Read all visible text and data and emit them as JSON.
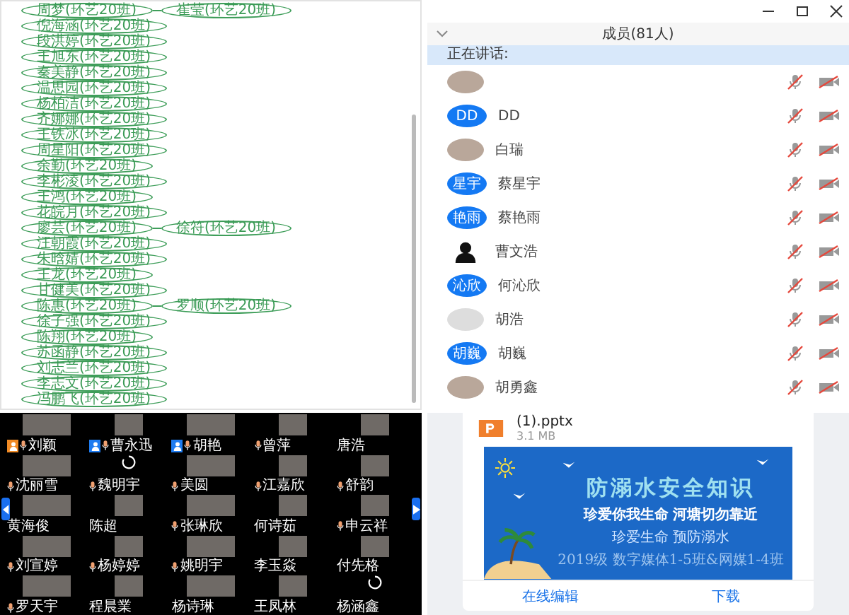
{
  "mindmap": {
    "items": [
      {
        "label": "周梦(环艺20班)",
        "children": [
          {
            "label": "崔莹(环艺20班)"
          }
        ]
      },
      {
        "label": "倪海涵(环艺20班)"
      },
      {
        "label": "段洪婷(环艺20班)"
      },
      {
        "label": "王旭东(环艺20班)"
      },
      {
        "label": "秦美静(环艺20班)"
      },
      {
        "label": "温思园(环艺20班)"
      },
      {
        "label": "杨柏洁(环艺20班)"
      },
      {
        "label": "齐娜娜(环艺20班)"
      },
      {
        "label": "王铁冰(环艺20班)"
      },
      {
        "label": "周星阳(环艺20班)"
      },
      {
        "label": "余勤(环艺20班)"
      },
      {
        "label": "李彬淩(环艺20班)"
      },
      {
        "label": "王鸿(环艺20班)"
      },
      {
        "label": "花皖月(环艺20班)"
      },
      {
        "label": "廖芸(环艺20班)",
        "children": [
          {
            "label": "徐符(环艺20班)"
          }
        ]
      },
      {
        "label": "汪朝霞(环艺20班)"
      },
      {
        "label": "朱晗婧(环艺20班)"
      },
      {
        "label": "王龙(环艺20班)"
      },
      {
        "label": "甘健美(环艺20班)"
      },
      {
        "label": "陈惠(环艺20班)",
        "children": [
          {
            "label": "罗顺(环艺20班)"
          }
        ]
      },
      {
        "label": "徐子强(环艺20班)"
      },
      {
        "label": "陈翔(环艺20班)"
      },
      {
        "label": "苏函静(环艺20班)"
      },
      {
        "label": "刘志兰(环艺20班)"
      },
      {
        "label": "李志文(环艺20班)"
      },
      {
        "label": "冯鹏飞(环艺20班)"
      }
    ]
  },
  "members": {
    "title": "成员(81人)",
    "speaking": "正在讲话:",
    "items": [
      {
        "kind": "photo",
        "mic_muted": true,
        "camera_off": true
      },
      {
        "name": "DD",
        "kind": "text",
        "avatar_text": "DD",
        "mic_muted": true,
        "camera_off": true
      },
      {
        "name": "白瑞",
        "kind": "photo",
        "mic_muted": true,
        "camera_off": true
      },
      {
        "name": "蔡星宇",
        "kind": "text",
        "avatar_text": "星宇",
        "mic_muted": true,
        "camera_off": true
      },
      {
        "name": "蔡艳雨",
        "kind": "text",
        "avatar_text": "艳雨",
        "mic_muted": true,
        "camera_off": true
      },
      {
        "name": "曹文浩",
        "kind": "silhouette",
        "mic_muted": true,
        "camera_off": true
      },
      {
        "name": "何沁欣",
        "kind": "text",
        "avatar_text": "沁欣",
        "mic_muted": true,
        "camera_off": true
      },
      {
        "name": "胡浩",
        "kind": "default",
        "mic_muted": true,
        "camera_off": true
      },
      {
        "name": "胡巍",
        "kind": "text",
        "avatar_text": "胡巍",
        "mic_muted": true,
        "camera_off": true
      },
      {
        "name": "胡勇鑫",
        "kind": "photo",
        "mic_muted": true,
        "camera_off": true
      }
    ]
  },
  "video_grid": {
    "tiles": [
      {
        "name": "刘颖",
        "kind": "video",
        "mic": true,
        "color": "#f08a24"
      },
      {
        "name": "曹永迅",
        "kind": "video",
        "mic": true,
        "color": "#1f7cf0"
      },
      {
        "name": "胡艳",
        "kind": "video",
        "mic": true,
        "color": "#1f7cf0"
      },
      {
        "name": "曾萍",
        "kind": "video",
        "mic": true
      },
      {
        "name": "唐浩",
        "kind": "video",
        "mic": false
      },
      {
        "name": "沈丽雪",
        "kind": "video",
        "mic": true
      },
      {
        "name": "魏明宇",
        "kind": "loading",
        "mic": true
      },
      {
        "name": "美圆",
        "kind": "video",
        "mic": true
      },
      {
        "name": "江嘉欣",
        "kind": "video",
        "mic": true
      },
      {
        "name": "舒韵",
        "kind": "video",
        "mic": true
      },
      {
        "name": "黄海俊",
        "kind": "video",
        "mic": false
      },
      {
        "name": "陈超",
        "kind": "video",
        "mic": false
      },
      {
        "name": "张琳欣",
        "kind": "video",
        "mic": true
      },
      {
        "name": "何诗茹",
        "kind": "video",
        "mic": false
      },
      {
        "name": "申云祥",
        "kind": "video",
        "mic": true
      },
      {
        "name": "刘宣婷",
        "kind": "video",
        "mic": true
      },
      {
        "name": "杨婷婷",
        "kind": "video",
        "mic": true
      },
      {
        "name": "姚明宇",
        "kind": "video",
        "mic": true
      },
      {
        "name": "李玉焱",
        "kind": "video",
        "mic": false
      },
      {
        "name": "付先格",
        "kind": "video",
        "mic": false
      },
      {
        "name": "罗天宇",
        "kind": "video",
        "mic": true
      },
      {
        "name": "程晨業",
        "kind": "video",
        "mic": false
      },
      {
        "name": "杨诗琳",
        "kind": "video",
        "mic": false
      },
      {
        "name": "王凤林",
        "kind": "video",
        "mic": false
      },
      {
        "name": "杨涵鑫",
        "kind": "loading",
        "mic": false
      }
    ]
  },
  "file_card": {
    "name": "(1).pptx",
    "size": "3.1 MB",
    "slide": {
      "title": "防溺水安全知识",
      "subtitle": "珍爱你我生命  河塘切勿靠近",
      "slogan": "珍爱生命  预防溺水",
      "classes": "2019级 数字媒体1-5班&网媒1-4班"
    },
    "buttons": [
      "在线编辑",
      "下载"
    ]
  }
}
